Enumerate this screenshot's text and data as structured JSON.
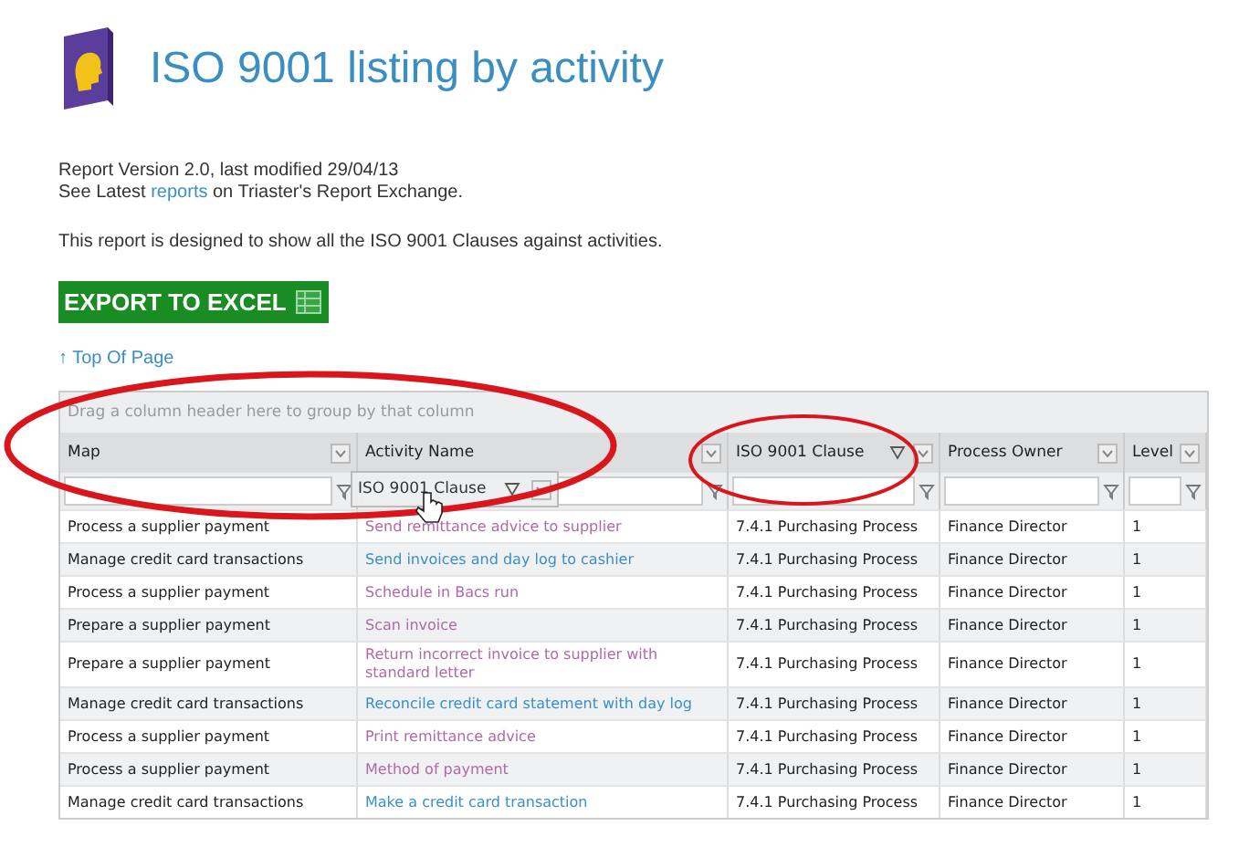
{
  "title": "ISO 9001 listing by activity",
  "version_line": "Report Version 2.0, last modified 29/04/13",
  "exchange_line": {
    "before": "See Latest",
    "link": "reports",
    "after": "on Triaster's Report Exchange."
  },
  "description": "This report is designed to show all the ISO 9001 Clauses against activities.",
  "export_button": "EXPORT TO EXCEL",
  "top_link": {
    "arrow": "↑",
    "label": "Top Of Page"
  },
  "group_panel": "Drag a column header here to group by that column",
  "columns": [
    {
      "label": "Map",
      "filter_active": false
    },
    {
      "label": "Activity Name",
      "filter_active": false
    },
    {
      "label": "ISO 9001 Clause",
      "filter_active": true
    },
    {
      "label": "Process Owner",
      "filter_active": false
    },
    {
      "label": "Level",
      "filter_active": false
    }
  ],
  "drag_ghost": {
    "label": "ISO 9001 Clause",
    "filter_active": true
  },
  "rows": [
    {
      "map": "Process a supplier payment",
      "activity": "Send remittance advice to supplier",
      "color": "#b06aa8",
      "clause": "7.4.1 Purchasing Process",
      "owner": "Finance Director",
      "level": "1"
    },
    {
      "map": "Manage credit card transactions",
      "activity": "Send invoices and day log to cashier",
      "color": "#3a8fc8",
      "clause": "7.4.1 Purchasing Process",
      "owner": "Finance Director",
      "level": "1"
    },
    {
      "map": "Process a supplier payment",
      "activity": "Schedule in Bacs run",
      "color": "#b06aa8",
      "clause": "7.4.1 Purchasing Process",
      "owner": "Finance Director",
      "level": "1"
    },
    {
      "map": "Prepare a supplier payment",
      "activity": "Scan invoice",
      "color": "#b06aa8",
      "clause": "7.4.1 Purchasing Process",
      "owner": "Finance Director",
      "level": "1"
    },
    {
      "map": "Prepare a supplier payment",
      "activity": "Return incorrect invoice to supplier with standard letter",
      "color": "#b06aa8",
      "clause": "7.4.1 Purchasing Process",
      "owner": "Finance Director",
      "level": "1"
    },
    {
      "map": "Manage credit card transactions",
      "activity": "Reconcile credit card statement with day log",
      "color": "#3a8fc8",
      "clause": "7.4.1 Purchasing Process",
      "owner": "Finance Director",
      "level": "1"
    },
    {
      "map": "Process a supplier payment",
      "activity": "Print remittance advice",
      "color": "#b06aa8",
      "clause": "7.4.1 Purchasing Process",
      "owner": "Finance Director",
      "level": "1"
    },
    {
      "map": "Process a supplier payment",
      "activity": "Method of payment",
      "color": "#b06aa8",
      "clause": "7.4.1 Purchasing Process",
      "owner": "Finance Director",
      "level": "1"
    },
    {
      "map": "Manage credit card transactions",
      "activity": "Make a credit card transaction",
      "color": "#3a8fc8",
      "clause": "7.4.1 Purchasing Process",
      "owner": "Finance Director",
      "level": "1"
    }
  ],
  "annotations": [
    {
      "kind": "ellipse"
    },
    {
      "kind": "ellipse"
    }
  ]
}
